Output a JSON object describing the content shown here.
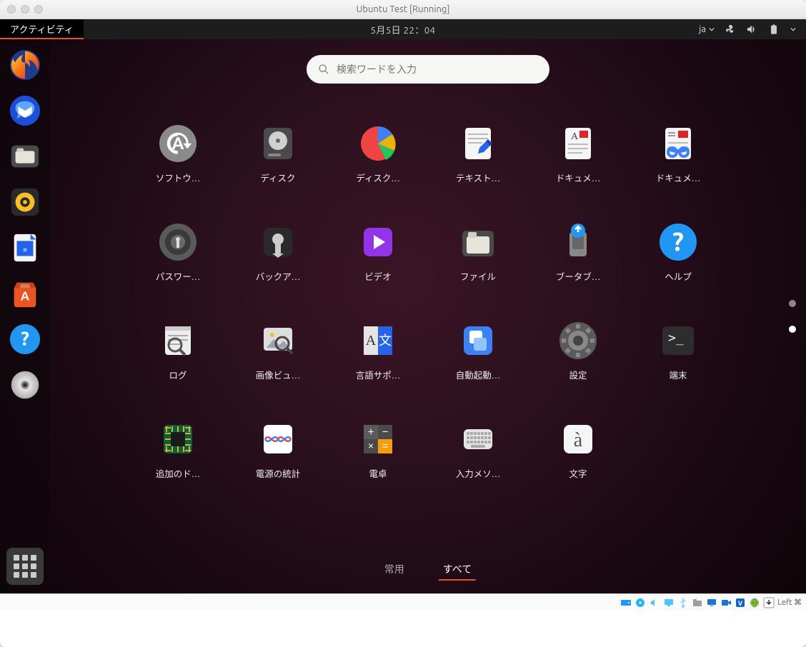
{
  "window": {
    "title": "Ubuntu Test [Running]"
  },
  "panel": {
    "activities": "アクティビティ",
    "clock": "5月5日  22：04",
    "ime": "ja"
  },
  "search": {
    "placeholder": "検索ワードを入力"
  },
  "pager": {
    "pages": 2,
    "active": 1
  },
  "filters": {
    "frequent": "常用",
    "all": "すべて",
    "active": "all"
  },
  "dock": [
    {
      "id": "firefox",
      "name": "Firefox"
    },
    {
      "id": "thunderbird",
      "name": "Thunderbird"
    },
    {
      "id": "files",
      "name": "Files"
    },
    {
      "id": "rhythmbox",
      "name": "Rhythmbox"
    },
    {
      "id": "libreoffice-writer",
      "name": "LibreOffice Writer"
    },
    {
      "id": "software",
      "name": "Ubuntu Software"
    },
    {
      "id": "help",
      "name": "Help"
    },
    {
      "id": "disc",
      "name": "Disc"
    }
  ],
  "apps": [
    {
      "id": "software-updater",
      "label": "ソフトウ…"
    },
    {
      "id": "disks",
      "label": "ディスク"
    },
    {
      "id": "disk-usage",
      "label": "ディスク…"
    },
    {
      "id": "text-editor",
      "label": "テキスト…"
    },
    {
      "id": "document-viewer",
      "label": "ドキュメ…"
    },
    {
      "id": "document-scanner",
      "label": "ドキュメ…"
    },
    {
      "id": "passwords",
      "label": "パスワー…"
    },
    {
      "id": "backups",
      "label": "バックア…"
    },
    {
      "id": "videos",
      "label": "ビデオ"
    },
    {
      "id": "files",
      "label": "ファイル"
    },
    {
      "id": "startup-disk",
      "label": "ブータブ…"
    },
    {
      "id": "help",
      "label": "ヘルプ"
    },
    {
      "id": "logs",
      "label": "ログ"
    },
    {
      "id": "image-viewer",
      "label": "画像ビュ…"
    },
    {
      "id": "language-support",
      "label": "言語サポ…"
    },
    {
      "id": "startup-apps",
      "label": "自動起動…"
    },
    {
      "id": "settings",
      "label": "設定"
    },
    {
      "id": "terminal",
      "label": "端末"
    },
    {
      "id": "additional-drivers",
      "label": "追加のド…"
    },
    {
      "id": "power-statistics",
      "label": "電源の統計"
    },
    {
      "id": "calculator",
      "label": "電卓"
    },
    {
      "id": "input-method",
      "label": "入力メソ…"
    },
    {
      "id": "characters",
      "label": "文字"
    }
  ],
  "statusbar": {
    "hostkey": "Left ⌘"
  }
}
